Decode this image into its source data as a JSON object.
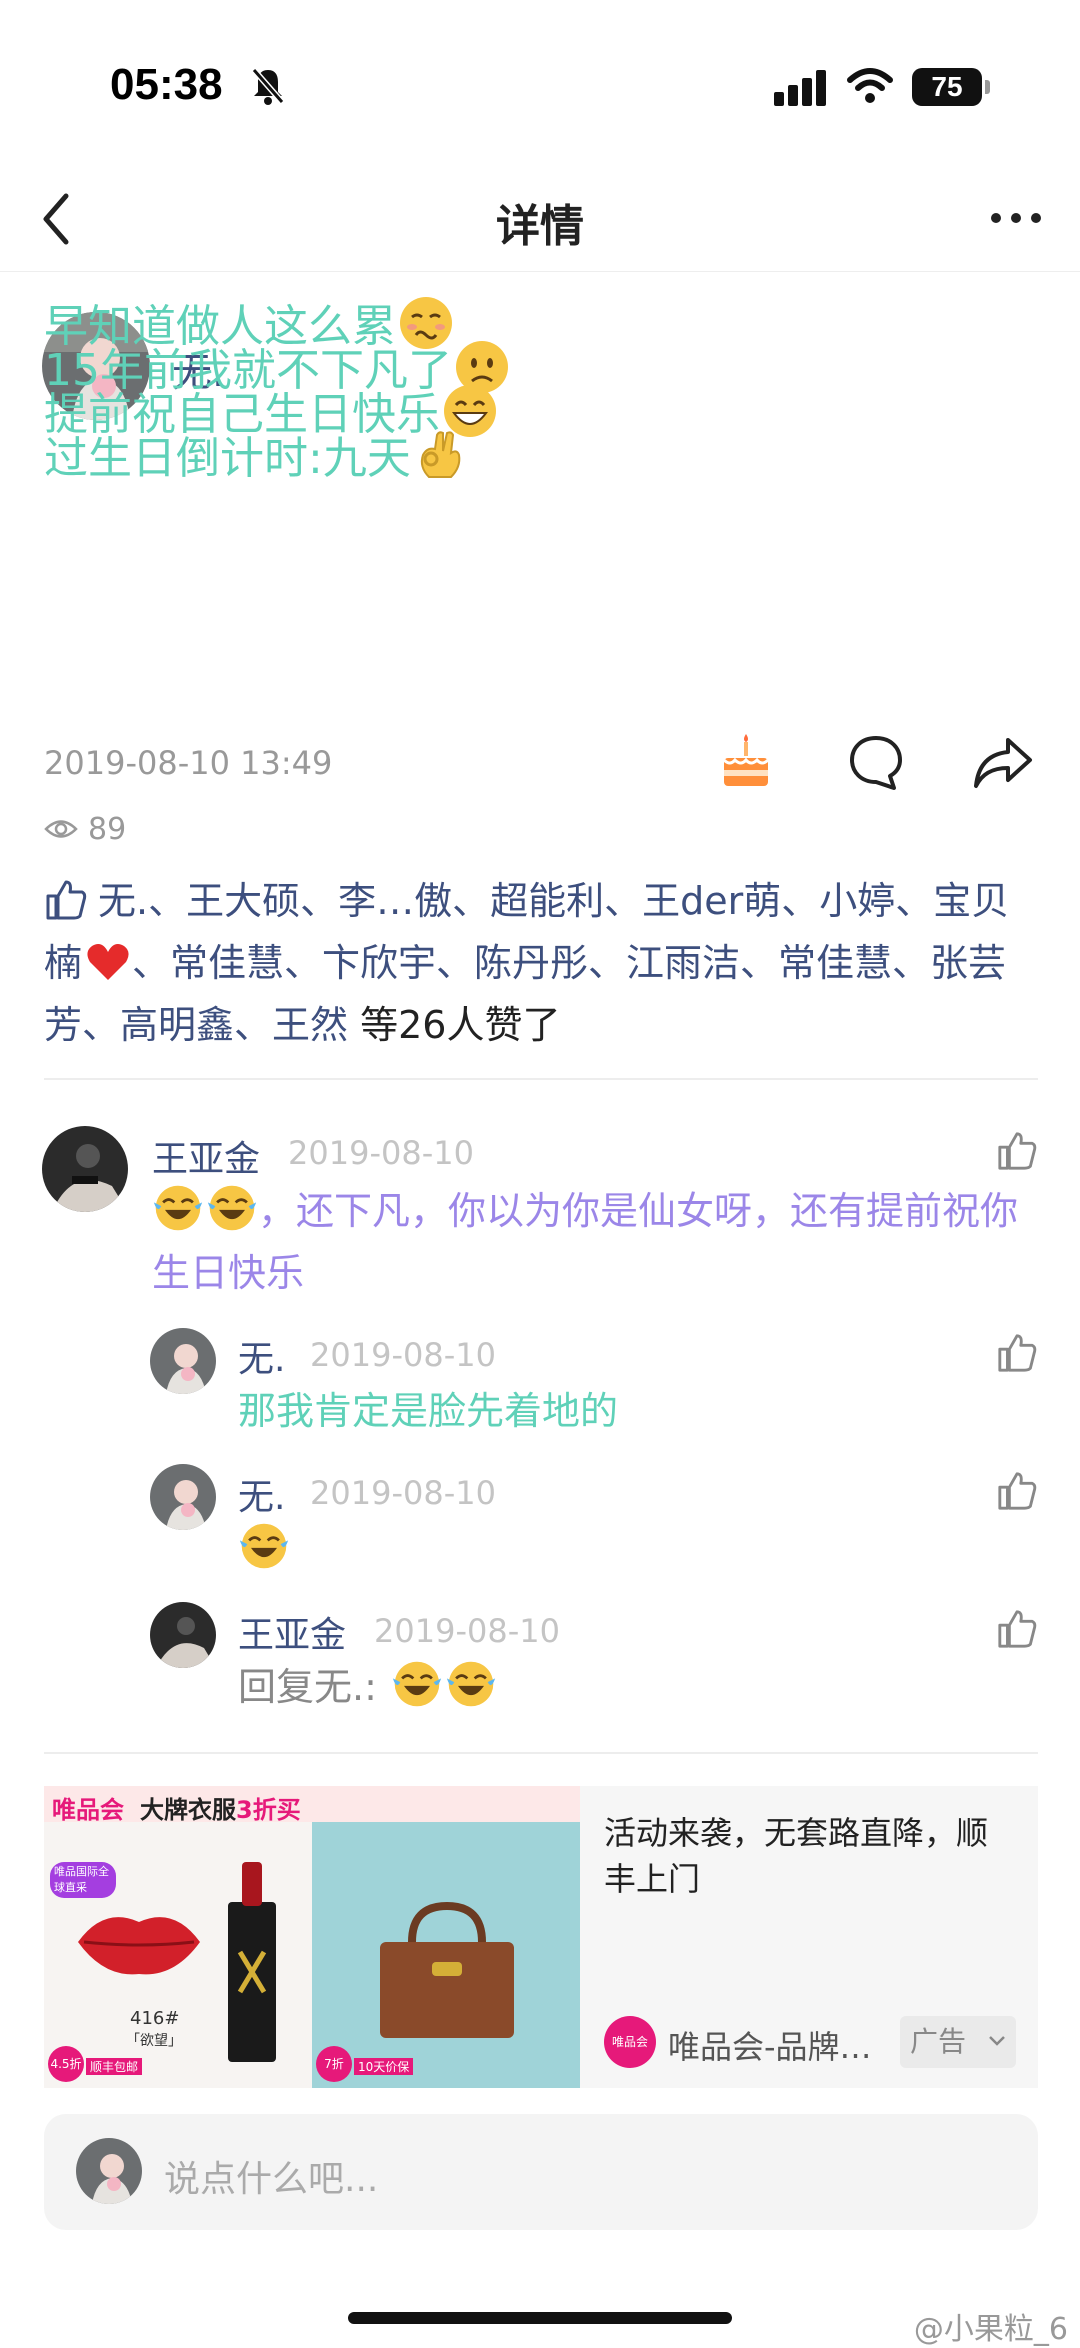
{
  "status_bar": {
    "time": "05:38",
    "battery": "75"
  },
  "nav": {
    "title": "详情"
  },
  "post": {
    "author": "无.",
    "lines": [
      "早知道做人这么累",
      "15年前我就不下凡了",
      "提前祝自己生日快乐",
      "过生日倒计时:九天"
    ],
    "time": "2019-08-10 13:49",
    "views": "89",
    "likes_names_1": "无.、王大硕、李…傲、超能利、王der萌、小婷、宝贝楠",
    "likes_names_2": "、常佳慧、卞欣宇、陈丹彤、江雨洁、常佳慧、张芸芳、高明鑫、王然",
    "likes_suffix": " 等26人赞了"
  },
  "comments": [
    {
      "name": "王亚金",
      "date": "2019-08-10",
      "text": "，还下凡，你以为你是仙女呀，还有提前祝你生日快乐"
    },
    {
      "name": "无.",
      "date": "2019-08-10",
      "text": "那我肯定是脸先着地的"
    },
    {
      "name": "无.",
      "date": "2019-08-10",
      "text": ""
    },
    {
      "name": "王亚金",
      "date": "2019-08-10",
      "text": "回复无.: "
    }
  ],
  "ad": {
    "title": "活动来袭，无套路直降，顺丰上门",
    "brand": "唯品会-品牌…",
    "badge": "广告",
    "banner": "唯品会",
    "banner_slogan": "大牌衣服",
    "banner_discount": "3折买",
    "tag": "唯品国际全球直采",
    "product_code": "416#",
    "product_name": "「欲望」",
    "discount_left": "4.5折",
    "discount_left_tag": "顺丰包邮",
    "discount_right": "7折",
    "discount_right_tag": "10天价保"
  },
  "input": {
    "placeholder": "说点什么吧..."
  },
  "watermark": "@小果粒_6",
  "colors": {
    "post_text": "#5fd1b8",
    "name": "#3d4f7e",
    "comment_purple": "#9b86e8",
    "reply_green": "#5fd1b8"
  }
}
